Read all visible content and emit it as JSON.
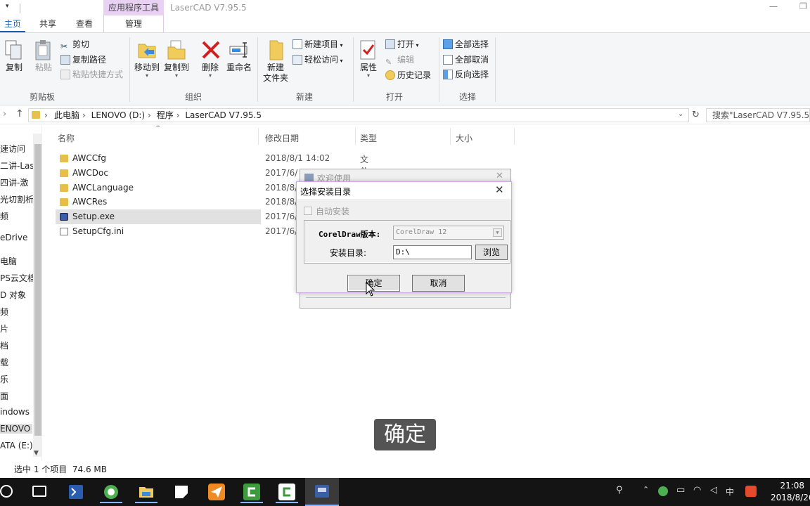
{
  "window": {
    "title": "LaserCAD V7.95.5",
    "context_tab": "应用程序工具",
    "minimize": "—",
    "maximize": "❐"
  },
  "ribbon_tabs": {
    "home": "主页",
    "share": "共享",
    "view": "查看",
    "manage": "管理"
  },
  "ribbon": {
    "clipboard": {
      "label": "剪贴板",
      "copy": "复制",
      "paste": "粘贴",
      "cut": "剪切",
      "copy_path": "复制路径",
      "paste_shortcut": "粘贴快捷方式"
    },
    "organize": {
      "label": "组织",
      "move_to": "移动到",
      "copy_to": "复制到",
      "delete": "删除",
      "rename": "重命名"
    },
    "new": {
      "label": "新建",
      "new_folder": "新建\n文件夹",
      "new_item": "新建项目",
      "easy_access": "轻松访问"
    },
    "open": {
      "label": "打开",
      "properties": "属性",
      "open": "打开",
      "edit": "编辑",
      "history": "历史记录"
    },
    "select": {
      "label": "选择",
      "select_all": "全部选择",
      "select_none": "全部取消",
      "invert": "反向选择"
    }
  },
  "address": {
    "crumbs": [
      "此电脑",
      "LENOVO (D:)",
      "程序",
      "LaserCAD V7.95.5"
    ],
    "separator": "›",
    "search_placeholder": "搜索\"LaserCAD V7.95.5\""
  },
  "nav_pane": [
    "速访问",
    "二讲-Las",
    "四讲-激",
    "光切割析",
    "频",
    "eDrive",
    "电脑",
    "PS云文档",
    "D 对象",
    "频",
    "片",
    "档",
    "载",
    "乐",
    "面",
    "indows",
    "ENOVO (",
    "ATA (E:)"
  ],
  "columns": {
    "name": "名称",
    "date": "修改日期",
    "type": "类型",
    "size": "大小"
  },
  "files": [
    {
      "name": "AWCCfg",
      "date": "2018/8/1 14:02",
      "type": "文件夹"
    },
    {
      "name": "AWCDoc",
      "date": "2017/6/",
      "type": ""
    },
    {
      "name": "AWCLanguage",
      "date": "2018/8/",
      "type": ""
    },
    {
      "name": "AWCRes",
      "date": "2018/8/",
      "type": ""
    },
    {
      "name": "Setup.exe",
      "date": "2017/6/",
      "type": ""
    },
    {
      "name": "SetupCfg.ini",
      "date": "2017/6/",
      "type": ""
    }
  ],
  "status": {
    "text": "选中 1 个项目  74.6 MB"
  },
  "welcome_dialog": {
    "title": "欢迎使用",
    "close": "✕"
  },
  "install_dialog": {
    "title": "选择安装目录",
    "close": "✕",
    "auto_install": "自动安装",
    "coreldraw_label": "CorelDraw版本:",
    "coreldraw_value": "CorelDraw 12",
    "dir_label": "安装目录:",
    "dir_value": "D:\\",
    "browse": "浏览",
    "ok": "确定",
    "cancel": "取消"
  },
  "subtitle": "确定",
  "taskbar": {
    "time": "21:08",
    "date": "2018/8/26",
    "ime": "中"
  },
  "colors": {
    "accent": "#1a5fb4",
    "context_tab": "#e9d1f4",
    "dialog_border": "#d3a7e8"
  }
}
